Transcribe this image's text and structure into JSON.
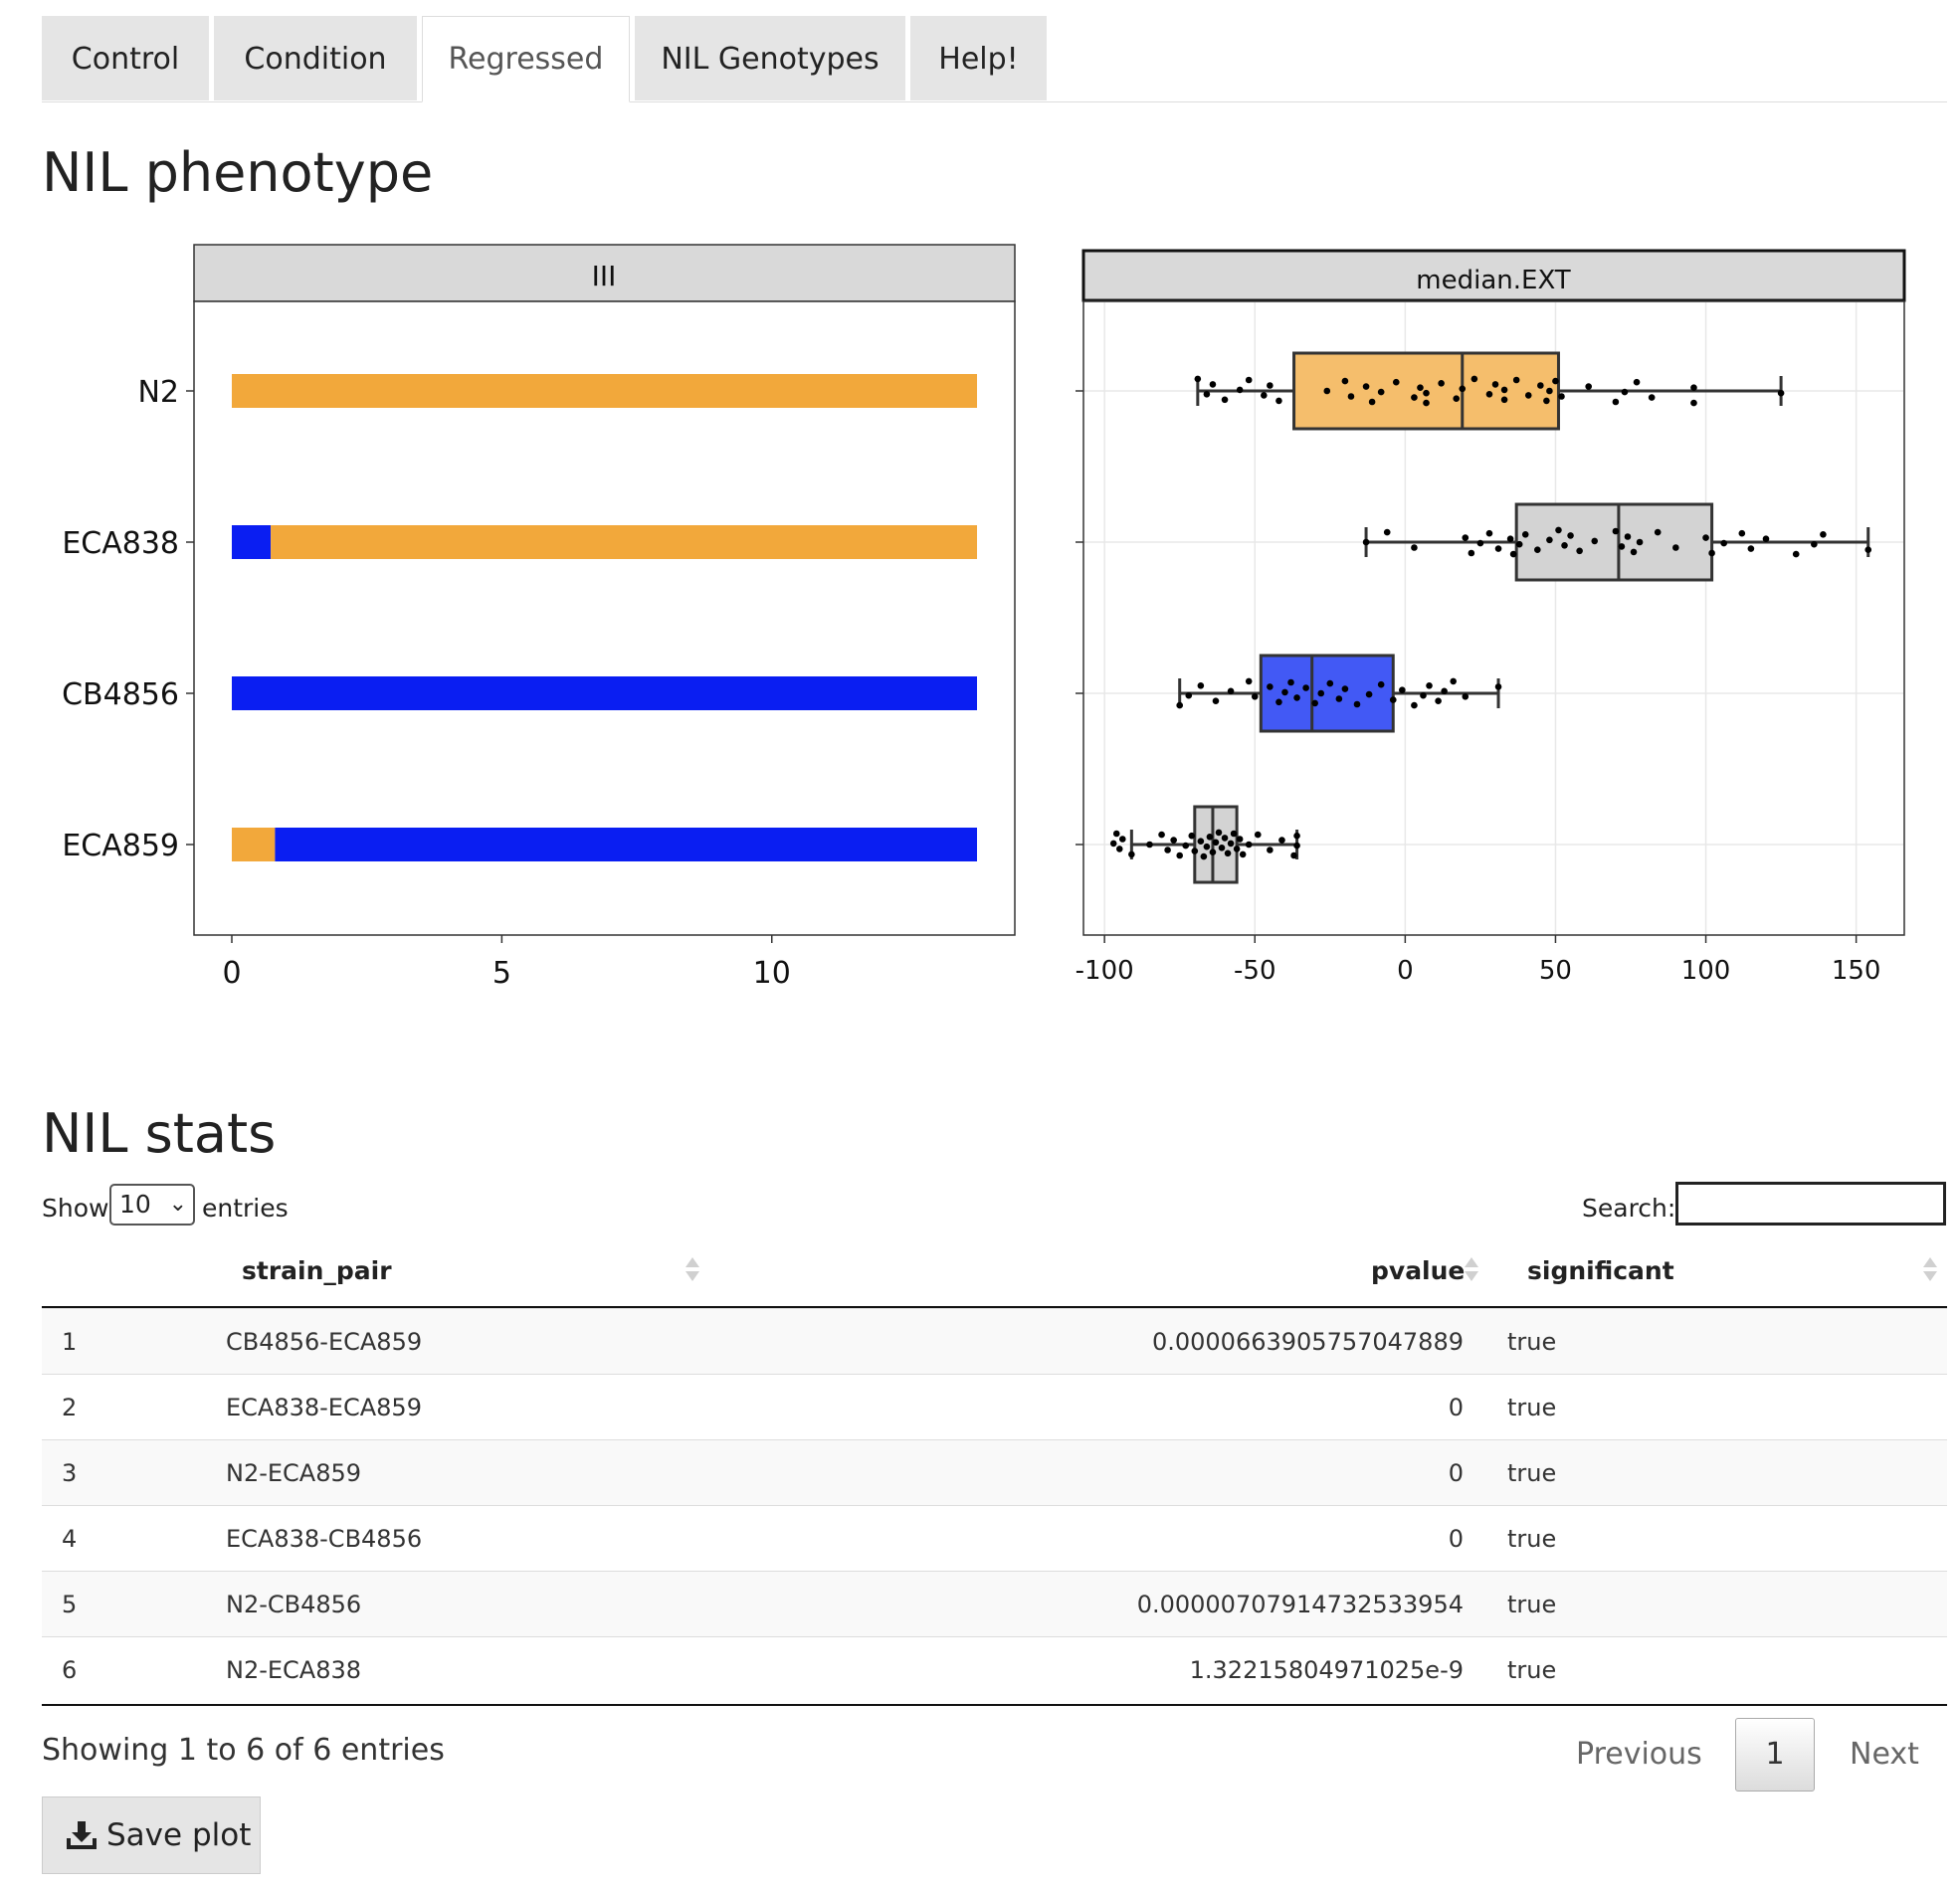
{
  "tabs": [
    {
      "label": "Control",
      "active": false
    },
    {
      "label": "Condition",
      "active": false
    },
    {
      "label": "Regressed",
      "active": true
    },
    {
      "label": "NIL Genotypes",
      "active": false
    },
    {
      "label": "Help!",
      "active": false
    }
  ],
  "phenotype_title": "NIL phenotype",
  "stats_title": "NIL stats",
  "chart_data": [
    {
      "type": "bar",
      "orientation": "horizontal",
      "facet_label": "III",
      "categories": [
        "N2",
        "ECA838",
        "CB4856",
        "ECA859"
      ],
      "xlim": [
        -0.7,
        14.5
      ],
      "x_ticks": [
        0,
        5,
        10
      ],
      "grid": false,
      "colors": {
        "N2": "#F2A83B",
        "CB4856": "#0A1EF2"
      },
      "segments": [
        [
          {
            "start": 0,
            "end": 13.8,
            "genotype": "N2"
          }
        ],
        [
          {
            "start": 0,
            "end": 0.72,
            "genotype": "CB4856"
          },
          {
            "start": 0.72,
            "end": 13.8,
            "genotype": "N2"
          }
        ],
        [
          {
            "start": 0,
            "end": 13.8,
            "genotype": "CB4856"
          }
        ],
        [
          {
            "start": 0,
            "end": 0.8,
            "genotype": "N2"
          },
          {
            "start": 0.8,
            "end": 13.8,
            "genotype": "CB4856"
          }
        ]
      ]
    },
    {
      "type": "box",
      "orientation": "horizontal",
      "facet_label": "median.EXT",
      "categories": [
        "N2",
        "ECA838",
        "CB4856",
        "ECA859"
      ],
      "xlim": [
        -107,
        166
      ],
      "x_ticks": [
        -100,
        -50,
        0,
        50,
        100,
        150
      ],
      "grid": true,
      "fill_colors": [
        "#F5BE6C",
        "#D3D3D3",
        "#4259F5",
        "#D3D3D3"
      ],
      "boxes": [
        {
          "strain": "N2",
          "whisker_low": -69,
          "q1": -37,
          "median": 19,
          "q3": 51,
          "whisker_high": 125
        },
        {
          "strain": "ECA838",
          "whisker_low": -13,
          "q1": 37,
          "median": 71,
          "q3": 102,
          "whisker_high": 154
        },
        {
          "strain": "CB4856",
          "whisker_low": -75,
          "q1": -48,
          "median": -31,
          "q3": -4,
          "whisker_high": 31
        },
        {
          "strain": "ECA859",
          "whisker_low": -91,
          "q1": -70,
          "median": -64,
          "q3": -56,
          "whisker_high": -36
        }
      ],
      "points": [
        [
          -69,
          -66,
          -64,
          -60,
          -55,
          -52,
          -47,
          -45,
          -42,
          -26,
          -20,
          -18,
          -13,
          -11,
          -8,
          -3,
          3,
          5,
          7,
          7,
          12,
          17,
          19,
          23,
          28,
          30,
          33,
          33,
          37,
          41,
          45,
          47,
          48,
          50,
          52,
          61,
          70,
          73,
          77,
          82,
          96,
          96,
          125
        ],
        [
          -13,
          -6,
          3,
          20,
          22,
          25,
          28,
          31,
          35,
          36,
          38,
          40,
          44,
          48,
          51,
          53,
          55,
          58,
          63,
          70,
          72,
          74,
          76,
          78,
          84,
          90,
          100,
          102,
          106,
          112,
          115,
          120,
          130,
          136,
          139,
          154
        ],
        [
          -75,
          -72,
          -68,
          -63,
          -58,
          -52,
          -50,
          -45,
          -42,
          -40,
          -38,
          -36,
          -33,
          -30,
          -28,
          -25,
          -22,
          -20,
          -16,
          -12,
          -8,
          -4,
          -1,
          3,
          6,
          8,
          11,
          13,
          16,
          20,
          31
        ],
        [
          -97,
          -96,
          -95,
          -94,
          -91,
          -85,
          -81,
          -79,
          -77,
          -75,
          -73,
          -71,
          -70,
          -68,
          -67,
          -66,
          -65,
          -64,
          -63,
          -62,
          -61,
          -60,
          -59,
          -58,
          -57,
          -56,
          -55,
          -54,
          -52,
          -49,
          -45,
          -41,
          -37,
          -36,
          -36
        ]
      ]
    }
  ],
  "table": {
    "length_label_pre": "Show",
    "length_value": "10",
    "length_label_post": "entries",
    "search_label": "Search:",
    "columns": [
      "strain_pair",
      "pvalue",
      "significant"
    ],
    "rows": [
      {
        "idx": "1",
        "strain_pair": "CB4856-ECA859",
        "pvalue": "0.0000663905757047889",
        "significant": "true"
      },
      {
        "idx": "2",
        "strain_pair": "ECA838-ECA859",
        "pvalue": "0",
        "significant": "true"
      },
      {
        "idx": "3",
        "strain_pair": "N2-ECA859",
        "pvalue": "0",
        "significant": "true"
      },
      {
        "idx": "4",
        "strain_pair": "ECA838-CB4856",
        "pvalue": "0",
        "significant": "true"
      },
      {
        "idx": "5",
        "strain_pair": "N2-CB4856",
        "pvalue": "0.00000707914732533954",
        "significant": "true"
      },
      {
        "idx": "6",
        "strain_pair": "N2-ECA838",
        "pvalue": "1.32215804971025e-9",
        "significant": "true"
      }
    ],
    "info": "Showing 1 to 6 of 6 entries",
    "prev_label": "Previous",
    "current_page": "1",
    "next_label": "Next"
  },
  "save_button": {
    "label": "Save plot",
    "icon": "download-icon"
  }
}
